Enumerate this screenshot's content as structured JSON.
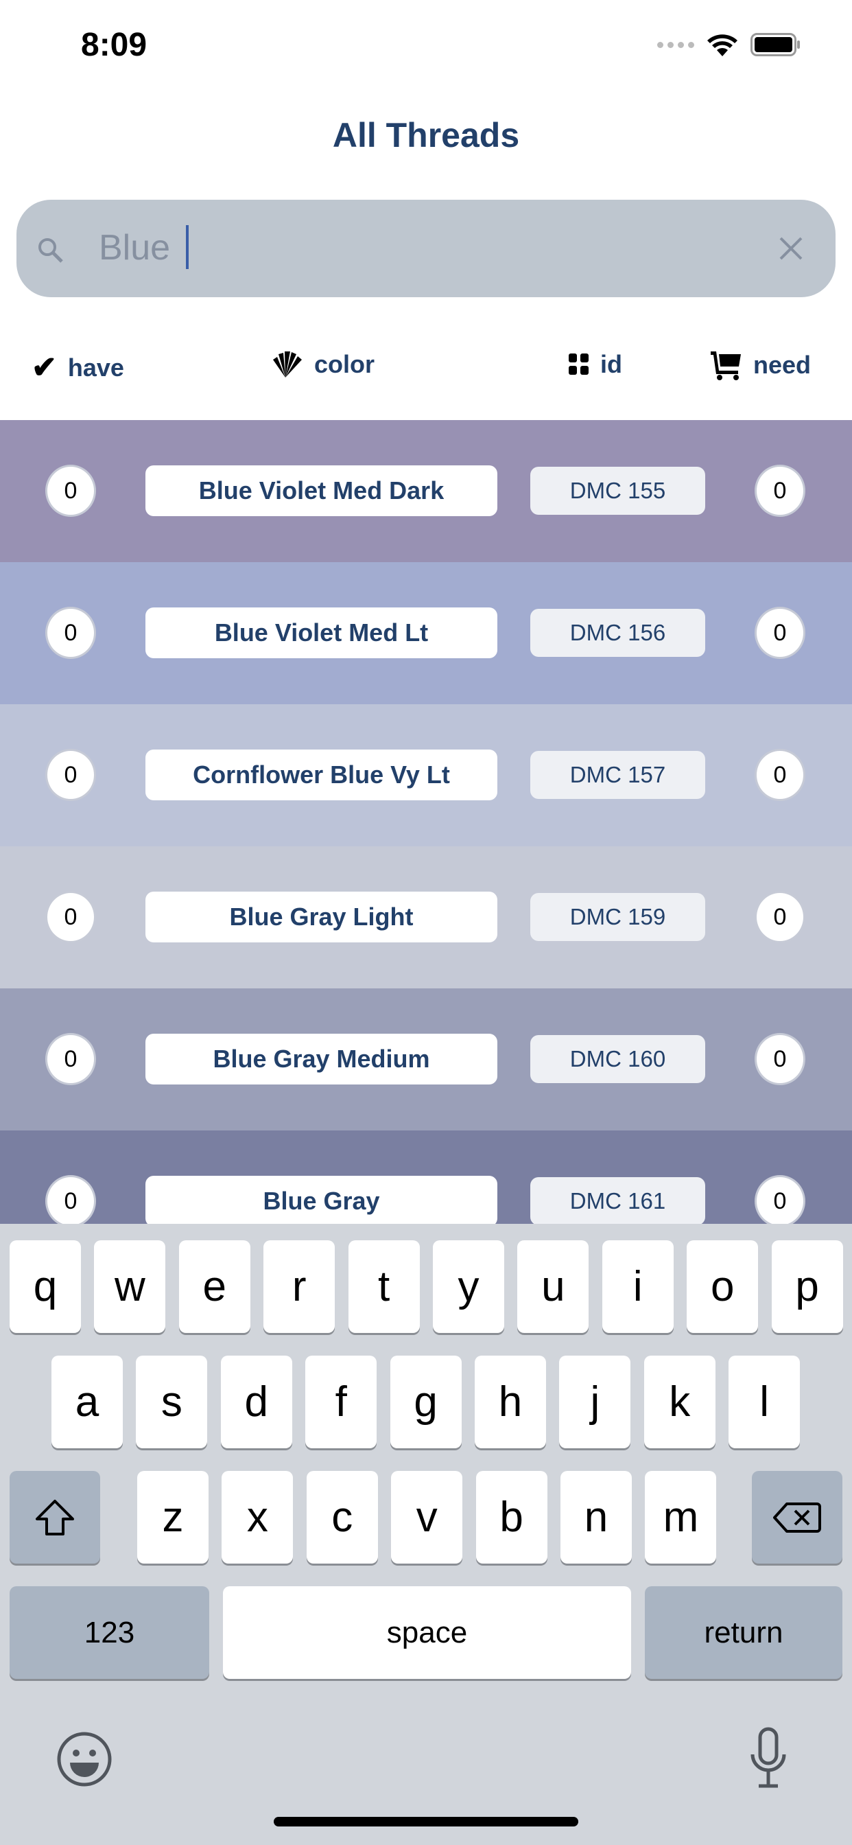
{
  "status": {
    "time": "8:09"
  },
  "header": {
    "title": "All Threads"
  },
  "search": {
    "value": "Blue"
  },
  "filters": [
    {
      "label": "have",
      "icon": "checkmark-icon"
    },
    {
      "label": "color",
      "icon": "color-swatch-icon"
    },
    {
      "label": "id",
      "icon": "grid-icon"
    },
    {
      "label": "need",
      "icon": "cart-icon"
    }
  ],
  "threads": [
    {
      "have": "0",
      "name": "Blue Violet Med Dark",
      "id": "DMC 155",
      "need": "0",
      "color": "#9891b3"
    },
    {
      "have": "0",
      "name": "Blue Violet Med Lt",
      "id": "DMC 156",
      "need": "0",
      "color": "#a2acd0"
    },
    {
      "have": "0",
      "name": "Cornflower Blue Vy Lt",
      "id": "DMC 157",
      "need": "0",
      "color": "#bcc3d8"
    },
    {
      "have": "0",
      "name": "Blue Gray Light",
      "id": "DMC 159",
      "need": "0",
      "color": "#c5c9d6"
    },
    {
      "have": "0",
      "name": "Blue Gray Medium",
      "id": "DMC 160",
      "need": "0",
      "color": "#9a9fb8"
    },
    {
      "have": "0",
      "name": "Blue Gray",
      "id": "DMC 161",
      "need": "0",
      "color": "#7a7fa1"
    }
  ],
  "keyboard": {
    "row1": [
      "q",
      "w",
      "e",
      "r",
      "t",
      "y",
      "u",
      "i",
      "o",
      "p"
    ],
    "row2": [
      "a",
      "s",
      "d",
      "f",
      "g",
      "h",
      "j",
      "k",
      "l"
    ],
    "row3": [
      "z",
      "x",
      "c",
      "v",
      "b",
      "n",
      "m"
    ],
    "numbers": "123",
    "space": "space",
    "return": "return"
  }
}
